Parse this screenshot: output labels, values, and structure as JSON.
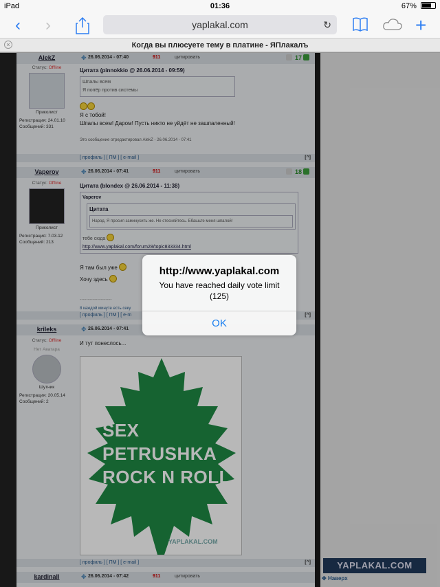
{
  "status_bar": {
    "device": "iPad",
    "time": "01:36",
    "battery": "67%"
  },
  "browser": {
    "url": "yaplakal.com",
    "tab_title": "Когда вы плюсуете тему в платине - ЯПлакалъ"
  },
  "posts": [
    {
      "author": "AlekZ",
      "date": "26.06.2014 - 07:40",
      "num": "911",
      "quote_btn": "цитировать",
      "rating": "17",
      "status_label": "Статус:",
      "status": "Offline",
      "rank": "Приколист",
      "reg": "Регистрация: 24.01.10",
      "msgs": "Сообщений: 331",
      "quote_header": "Цитата (pinnokkio @ 26.06.2014 - 09:59)",
      "quote_lines": [
        "Шпалы всем",
        "Я попёр против системы"
      ],
      "text_lines": [
        "Я с тобой!",
        "Шпалы всем! Даром! Пусть никто не уйдёт не зашпаленный!"
      ],
      "edited": "Это сообщение отредактировал AlekZ - 26.06.2014 - 07:41",
      "footer": "[ профиль ] [ ПМ ] [ e-mail ]"
    },
    {
      "author": "Vaperov",
      "date": "26.06.2014 - 07:41",
      "num": "911",
      "quote_btn": "цитировать",
      "rating": "18",
      "status_label": "Статус:",
      "status": "Offline",
      "rank": "Приколист",
      "reg": "Регистрация: 7.03.12",
      "msgs": "Сообщений: 213",
      "quote_header": "Цитата (blondex @ 26.06.2014 - 11:38)",
      "inner_author": "Vaperov",
      "inner_quote_header": "Цитата",
      "inner_quote": "Народ. Я просил заминусить же. Не стесняйтесь. Ебашьте меня шпалой!",
      "quote_reply": "тебе сюда",
      "quote_link": "http://www.yaplakal.com/forum28/topic833334.html",
      "text_lines": [
        "Я там был уже",
        "Хочу здесь"
      ],
      "separator": "--------------------",
      "note": "8 каждой минуте есть секу",
      "footer": "[ профиль ] [ ПМ ] [ e-m"
    },
    {
      "author": "krileks",
      "date": "26.06.2014 - 07:41",
      "status_label": "Статус:",
      "status": "Offline",
      "avatar_caption": "Нет Аватара",
      "rank": "Шутник",
      "reg": "Регистрация: 20.05.14",
      "msgs": "Сообщений: 2",
      "text": "И тут понеслось...",
      "poster_lines": [
        "SEX",
        "PETRUSHKA",
        "ROCK N ROLL"
      ],
      "poster_site": "YAPLAKAL.COM",
      "footer": "[ профиль ] [ ПМ ] [ e-mail ]"
    },
    {
      "author": "kardinall",
      "date": "26.06.2014 - 07:42",
      "num": "911",
      "quote_btn": "цитировать"
    }
  ],
  "side": {
    "logo": "YAPLAKAL.COM",
    "top_link": "Наверх",
    "up_button": "[^]"
  },
  "alert": {
    "title": "http://www.yaplakal.com",
    "message": "You have reached daily vote limit (125)",
    "ok": "OK"
  },
  "colors": {
    "link_blue": "#1a7ff0",
    "leaf_green": "#1f8a45",
    "offline_red": "#d33"
  }
}
